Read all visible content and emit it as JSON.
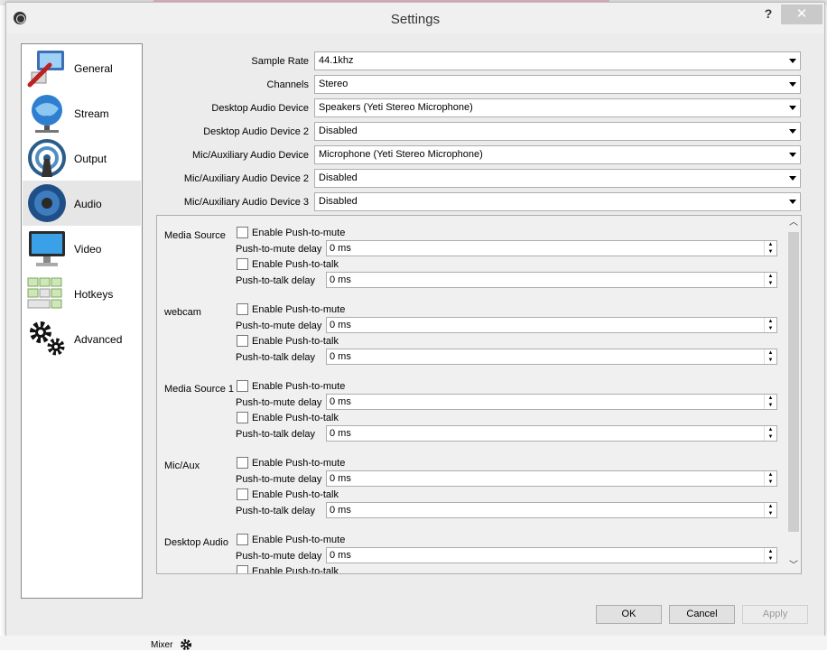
{
  "window": {
    "title": "Settings",
    "help": "?",
    "close": "✕"
  },
  "sidebar": {
    "items": [
      {
        "label": "General",
        "icon": "general-icon"
      },
      {
        "label": "Stream",
        "icon": "stream-icon"
      },
      {
        "label": "Output",
        "icon": "output-icon"
      },
      {
        "label": "Audio",
        "icon": "audio-icon",
        "selected": true
      },
      {
        "label": "Video",
        "icon": "video-icon"
      },
      {
        "label": "Hotkeys",
        "icon": "hotkeys-icon"
      },
      {
        "label": "Advanced",
        "icon": "advanced-icon"
      }
    ]
  },
  "audio": {
    "fields": [
      {
        "label": "Sample Rate",
        "value": "44.1khz"
      },
      {
        "label": "Channels",
        "value": "Stereo"
      },
      {
        "label": "Desktop Audio Device",
        "value": "Speakers (Yeti Stereo Microphone)"
      },
      {
        "label": "Desktop Audio Device 2",
        "value": "Disabled"
      },
      {
        "label": "Mic/Auxiliary Audio Device",
        "value": "Microphone (Yeti Stereo Microphone)"
      },
      {
        "label": "Mic/Auxiliary Audio Device 2",
        "value": "Disabled"
      },
      {
        "label": "Mic/Auxiliary Audio Device 3",
        "value": "Disabled"
      }
    ],
    "hotkey_sources": [
      {
        "name": "Media Source"
      },
      {
        "name": "webcam"
      },
      {
        "name": "Media Source 1"
      },
      {
        "name": "Mic/Aux"
      },
      {
        "name": "Desktop Audio"
      }
    ],
    "enable_mute_label": "Enable Push-to-mute",
    "mute_delay_label": "Push-to-mute delay",
    "enable_talk_label": "Enable Push-to-talk",
    "talk_delay_label": "Push-to-talk delay",
    "delay_value": "0 ms"
  },
  "buttons": {
    "ok": "OK",
    "cancel": "Cancel",
    "apply": "Apply"
  },
  "background": {
    "mixer_label": "Mixer"
  }
}
